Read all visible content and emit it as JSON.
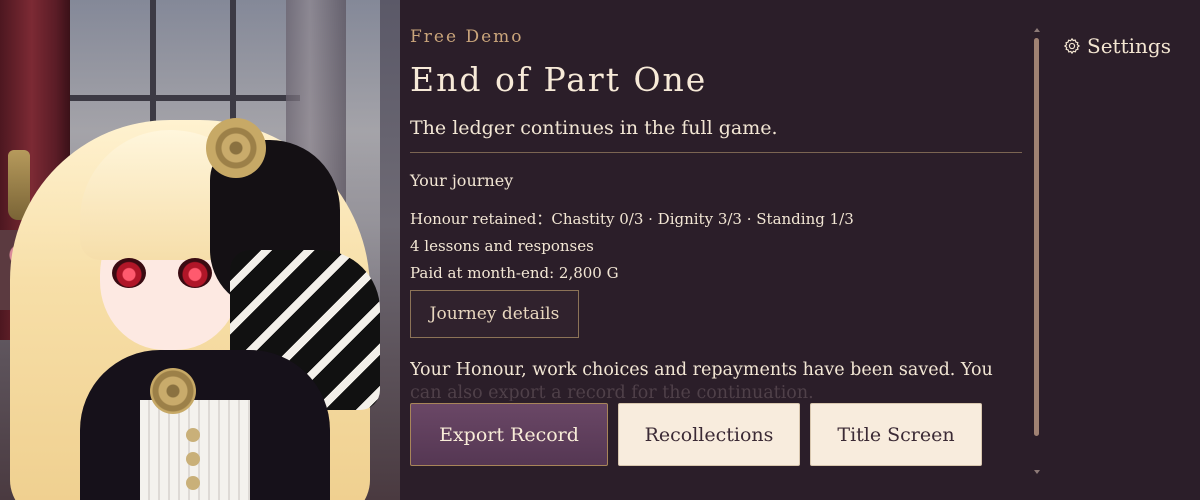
{
  "screen": {
    "kicker": "Free Demo",
    "title": "End of Part One",
    "subtitle": "The ledger continues in the full game."
  },
  "journey": {
    "heading": "Your journey",
    "honour_line": "Honour retained：Chastity 0/3 · Dignity 3/3 · Standing 1/3",
    "lessons_line": "4 lessons and responses",
    "paid_line": "Paid at month-end: 2,800 G",
    "details_button": "Journey details"
  },
  "message": {
    "line1": "Your Honour, work choices and repayments have been saved. You",
    "line2": "can also export a record for the continuation."
  },
  "actions": {
    "export": "Export Record",
    "recollections": "Recollections",
    "title_screen": "Title Screen"
  },
  "settings": {
    "label": "Settings",
    "icon": "gear-icon"
  },
  "colors": {
    "panel_bg": "#2b1e29",
    "accent_gold": "#caa57b",
    "primary_button": "#5f3f5c",
    "light_button": "#f8ecdd"
  }
}
